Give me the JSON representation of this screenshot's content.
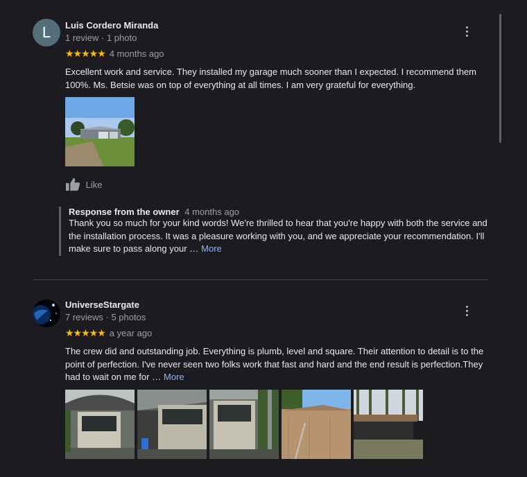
{
  "reviews": [
    {
      "author": "Luis Cordero Miranda",
      "avatar_letter": "L",
      "meta": "1 review · 1 photo",
      "stars": "★★★★★",
      "when": "4 months ago",
      "text": "Excellent work and service. They installed my garage much sooner than I expected. I recommend them 100%. Ms. Betsie was on top of everything at all times. I am very grateful for everything.",
      "like_label": "Like",
      "response": {
        "title": "Response from the owner",
        "when": "4 months ago",
        "text": "Thank you so much for your kind words! We're thrilled to hear that you're happy with both the service and the installation process. It was a pleasure working with you, and we appreciate your recommendation. I'll make sure to pass along your …",
        "more": "More"
      }
    },
    {
      "author": "UniverseStargate",
      "meta": "7 reviews · 5 photos",
      "stars": "★★★★★",
      "when": "a year ago",
      "text": "The crew did and outstanding job. Everything is plumb, level and square. Their attention to detail is to the point of perfection. I've never seen two folks work that fast and hard and the end result is perfection.They had to wait on me for …",
      "more": "More"
    }
  ],
  "colors": {
    "star": "#fbbc04",
    "link": "#8ab4f8",
    "background": "#1b1b20"
  },
  "icons": [
    "more-vert-icon",
    "thumbs-up-icon"
  ]
}
